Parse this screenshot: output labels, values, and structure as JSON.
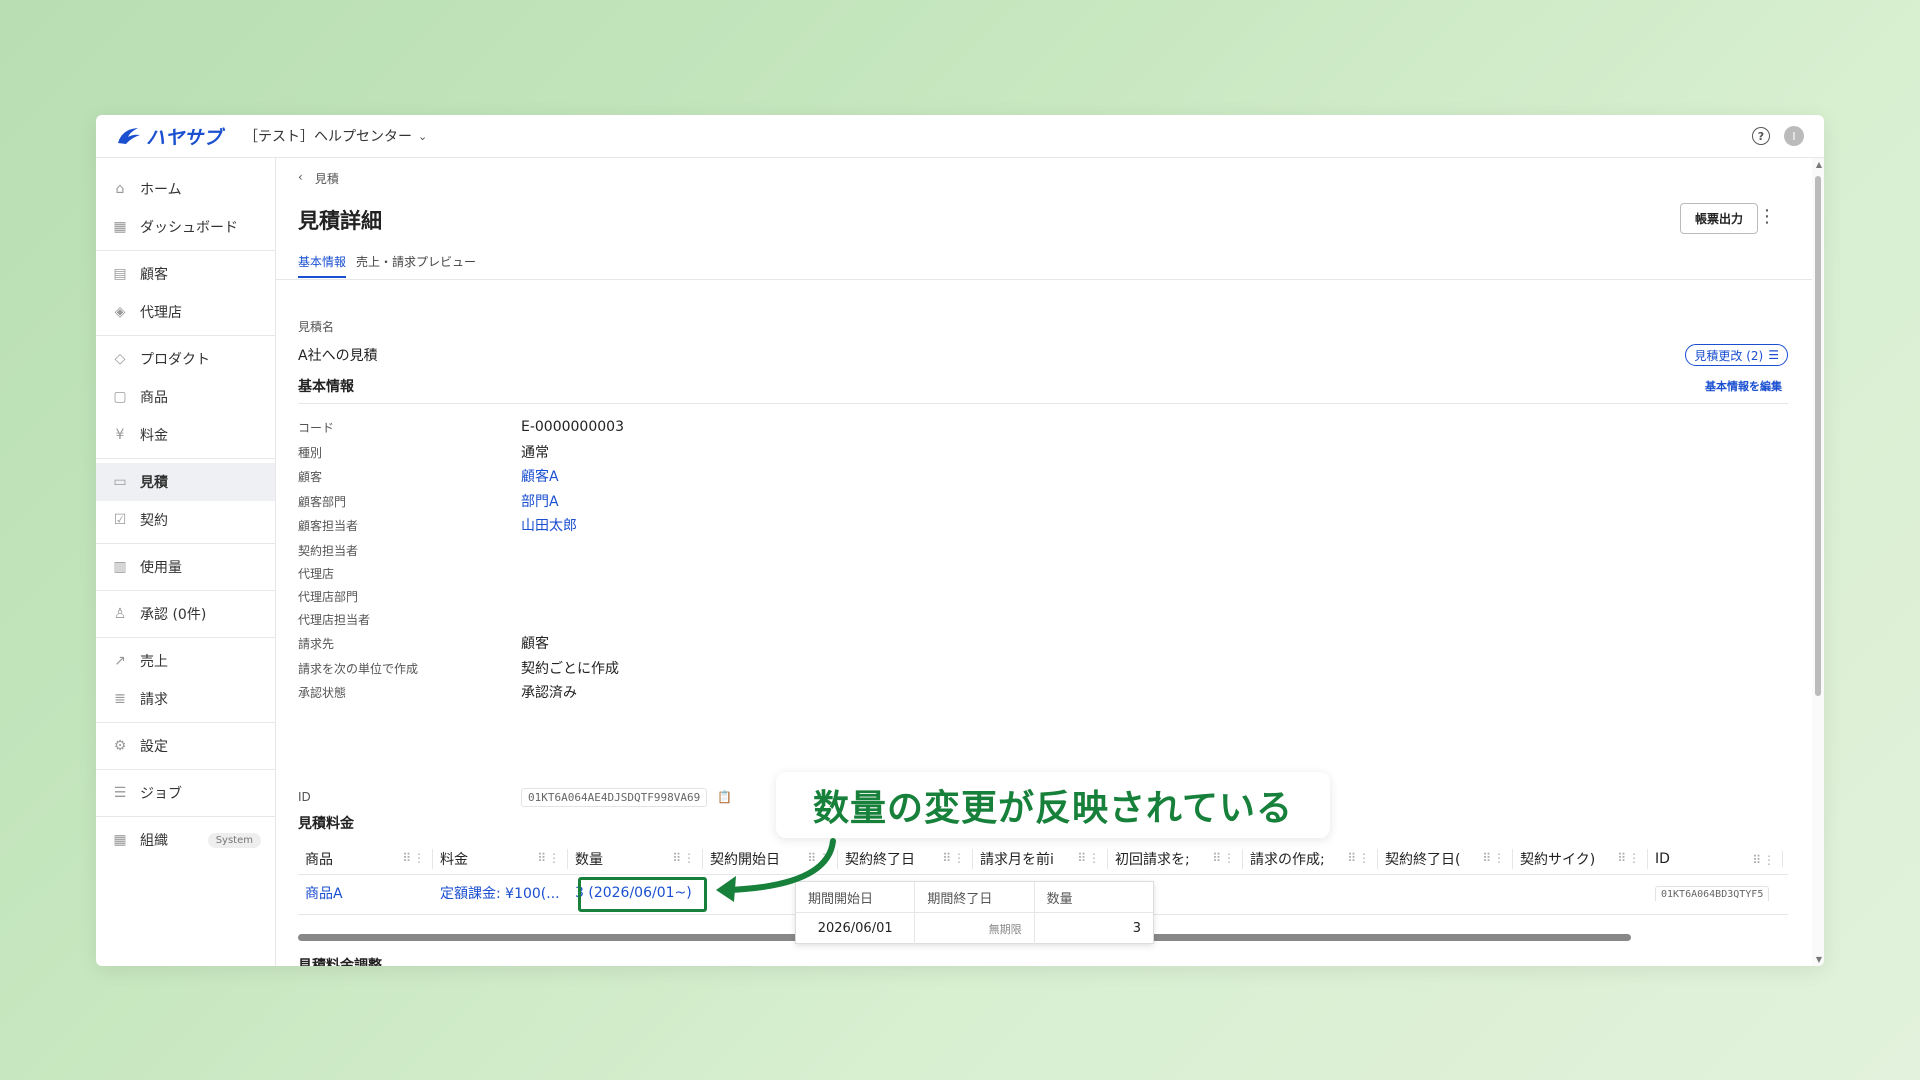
{
  "header": {
    "logo_text": "ハヤサブ",
    "workspace": "［テスト］ヘルプセンター",
    "help_icon": "?",
    "avatar_initial": "I"
  },
  "sidebar": {
    "groups": [
      [
        {
          "label": "ホーム",
          "icon": "home-icon"
        },
        {
          "label": "ダッシュボード",
          "icon": "dashboard-icon"
        }
      ],
      [
        {
          "label": "顧客",
          "icon": "building-icon"
        },
        {
          "label": "代理店",
          "icon": "handshake-icon"
        }
      ],
      [
        {
          "label": "プロダクト",
          "icon": "layers-icon"
        },
        {
          "label": "商品",
          "icon": "bag-icon"
        },
        {
          "label": "料金",
          "icon": "yen-icon"
        }
      ],
      [
        {
          "label": "見積",
          "icon": "document-icon",
          "active": true
        },
        {
          "label": "契約",
          "icon": "contract-icon"
        }
      ],
      [
        {
          "label": "使用量",
          "icon": "bar-chart-icon"
        }
      ],
      [
        {
          "label": "承認 (0件)",
          "icon": "stamp-icon"
        }
      ],
      [
        {
          "label": "売上",
          "icon": "trend-icon"
        },
        {
          "label": "請求",
          "icon": "invoice-icon"
        }
      ],
      [
        {
          "label": "設定",
          "icon": "gear-icon"
        }
      ],
      [
        {
          "label": "ジョブ",
          "icon": "list-icon"
        }
      ],
      [
        {
          "label": "組織",
          "icon": "org-icon",
          "badge": "System"
        }
      ]
    ]
  },
  "main": {
    "breadcrumb": "見積",
    "title": "見積詳細",
    "export_label": "帳票出力",
    "tabs": [
      {
        "label": "基本情報",
        "active": true
      },
      {
        "label": "売上・請求プレビュー"
      }
    ],
    "estimate_name_label": "見積名",
    "estimate_name": "A社への見積",
    "revision_label": "見積更改 (2)",
    "edit_link": "基本情報を編集",
    "basic_info_title": "基本情報",
    "fields": [
      {
        "label": "コード",
        "value": "E-0000000003"
      },
      {
        "label": "種別",
        "value": "通常"
      },
      {
        "label": "顧客",
        "value": "顧客A",
        "link": true
      },
      {
        "label": "顧客部門",
        "value": "部門A",
        "link": true
      },
      {
        "label": "顧客担当者",
        "value": "山田太郎",
        "link": true
      },
      {
        "label": "契約担当者",
        "value": ""
      },
      {
        "label": "代理店",
        "value": ""
      },
      {
        "label": "代理店部門",
        "value": ""
      },
      {
        "label": "代理店担当者",
        "value": ""
      },
      {
        "label": "請求先",
        "value": "顧客"
      },
      {
        "label": "請求を次の単位で作成",
        "value": "契約ごとに作成"
      },
      {
        "label": "承認状態",
        "value": "承認済み"
      }
    ],
    "id_label": "ID",
    "id_value": "01KT6A064AE4DJSDQTF998VA69",
    "fees_title": "見積料金",
    "fees_columns": [
      "商品",
      "料金",
      "数量",
      "契約開始日",
      "契約終了日",
      "請求月を前i",
      "初回請求を;",
      "請求の作成;",
      "契約終了日(",
      "契約サイク)",
      "ID"
    ],
    "fees_row": [
      "商品A",
      "定額課金: ¥100(...",
      "3 (2026/06/01~)",
      "",
      "",
      "",
      "",
      "",
      "",
      "",
      "01KT6A064BD3QTYF5"
    ],
    "popover": {
      "headers": [
        "期間開始日",
        "期間終了日",
        "数量"
      ],
      "row": [
        "2026/06/01",
        "無期限",
        "3"
      ]
    },
    "adjust_title": "見積料金調整"
  },
  "annotation": {
    "text": "数量の変更が反映されている",
    "color": "#17803a"
  }
}
